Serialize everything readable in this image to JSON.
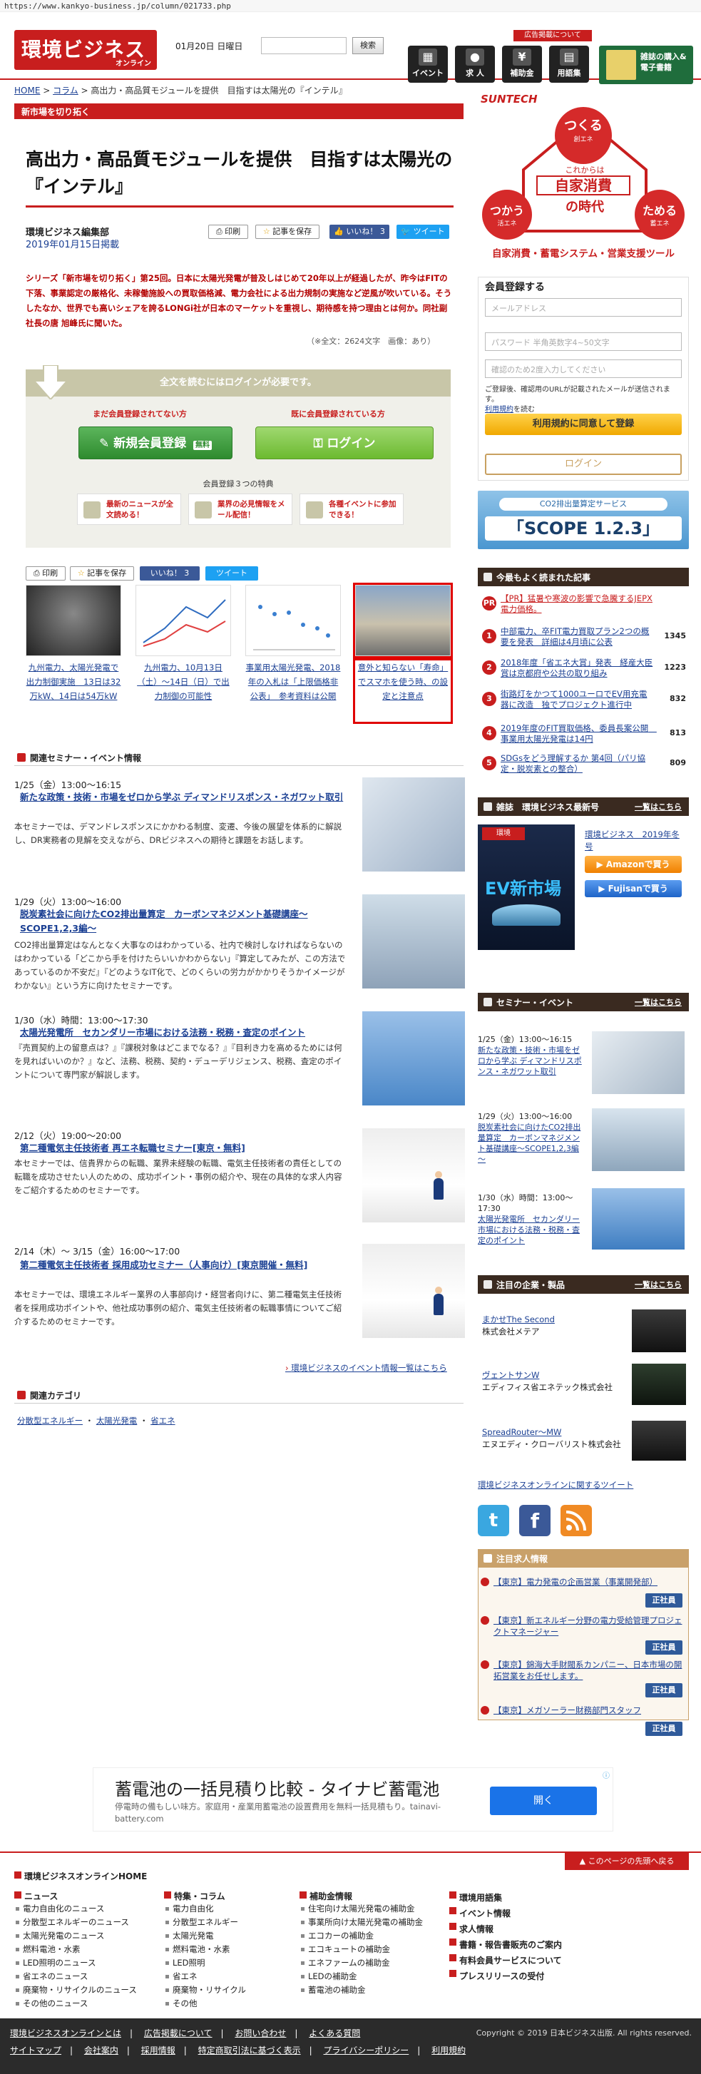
{
  "browser": {
    "url": "https://www.kankyo-business.jp/column/021733.php"
  },
  "header": {
    "logo_main": "環境ビジネス",
    "logo_sub": "オンライン",
    "date": "01月20日 日曜日",
    "search_button": "検索",
    "ad_label": "広告掲載について",
    "nav": [
      {
        "label": "イベント",
        "icon": "calendar-icon"
      },
      {
        "label": "求 人",
        "icon": "person-icon"
      },
      {
        "label": "補助金",
        "icon": "yen-icon"
      },
      {
        "label": "用語集",
        "icon": "book-icon"
      }
    ],
    "banner_text": "雑誌の購入&電子書籍"
  },
  "breadcrumb": [
    "HOME",
    "コラム",
    "高出力・高品質モジュールを提供　目指すは太陽光の『インテル』"
  ],
  "series_label": "新市場を切り拓く",
  "article": {
    "title": "高出力・高品質モジュールを提供　目指すは太陽光の『インテル』",
    "author": "環境ビジネス編集部",
    "published": "2019年01月15日掲載",
    "buttons": {
      "print": "印刷",
      "save": "記事を保存",
      "like": "いいね！ 3",
      "tweet": "ツイート"
    },
    "lead": "シリーズ「新市場を切り拓く」第25回。日本に太陽光発電が普及しはじめて20年以上が経過したが、昨今はFITの下落、事業認定の厳格化、未稼働施設への買取価格減、電力会社による出力規制の実施など逆風が吹いている。そうしたなか、世界でも高いシェアを誇るLONGi社が日本のマーケットを重視し、期待感を持つ理由とは何か。同社副社長の唐 旭峰氏に聞いた。",
    "lead_links": [
      "太陽光発電",
      "FIT"
    ],
    "stats": "（※全文：2624文字　画像：あり）"
  },
  "login_box": {
    "heading": "全文を読むにはログインが必要です。",
    "col_new": "まだ会員登録されてない方",
    "col_member": "既に会員登録されている方",
    "register_button": "新規会員登録",
    "register_badge": "無料",
    "login_button": "ログイン",
    "merits_title": "会員登録３つの特典",
    "merits": [
      "最新のニュースが全文読める！",
      "業界の必見情報をメール配信！",
      "各種イベントに参加できる！"
    ]
  },
  "related": [
    {
      "caption": "九州電力、太陽光発電で出力制御実施　13日は32万kW、14日は54万kW"
    },
    {
      "caption": "九州電力、10月13日（土）～14日（日）で出力制御の可能性"
    },
    {
      "caption": "事業用太陽光発電、2018年の入札は「上限価格非公表」　参考資料は公開"
    },
    {
      "caption": "意外と知らない「寿命」でスマホを使う時、の設定と注意点"
    }
  ],
  "seminars": {
    "heading": "関連セミナー・イベント情報",
    "items": [
      {
        "date": "1/25（金）13:00～16:15",
        "title": "新たな政策・技術・市場をゼロから学ぶ ディマンドリスポンス・ネガワット取引",
        "desc": "本セミナーでは、デマンドレスポンスにかかわる制度、変遷、今後の展望を体系的に解説し、DR実務者の見解を交えながら、DRビジネスへの期待と課題をお話します。"
      },
      {
        "date": "1/29（火）13:00～16:00",
        "title": "脱炭素社会に向けたCO2排出量算定　カーボンマネジメント基礎講座～SCOPE1,2,3編～",
        "desc": "CO2排出量算定はなんとなく大事なのはわかっている、社内で検討しなければならないのはわかっている「どこから手を付けたらいいかわからない」『算定してみたが、この方法であっているのか不安だ』『どのようなIT化で、どのくらいの労力がかかりそうかイメージがわかない』という方に向けたセミナーです。"
      },
      {
        "date": "1/30（水）時間：13:00～17:30",
        "title": "太陽光発電所　セカンダリー市場における法務・税務・査定のポイント",
        "desc": "『売買契約上の留意点は？』『課税対象はどこまでなる？』『目利き力を高めるためには何を見ればいいのか？』など、法務、税務、契約・デューデリジェンス、税務、査定のポイントについて専門家が解説します。"
      },
      {
        "date": "2/12（火）19:00～20:00",
        "title": "第二種電気主任技術者 再エネ転職セミナー[東京・無料]",
        "desc": "本セミナーでは、信貴界からの転職、業界未経験の転職、電気主任技術者の責任としての転職を成功させたい人のための、成功ポイント・事例の紹介や、現在の具体的な求人内容をご紹介するためのセミナーです。"
      },
      {
        "date": "2/14（木）～ 3/15（金）16:00～17:00",
        "title": "第二種電気主任技術者 採用成功セミナー（人事向け）[東京開催・無料]",
        "desc": "本セミナーでは、環境エネルギー業界の人事部向け・経営者向けに、第二種電気主任技術者を採用成功ポイントや、他社成功事例の紹介、電気主任技術者の転職事情についてご紹介するためのセミナーです。"
      }
    ],
    "more_link": "環境ビジネスのイベント情報一覧はこちら"
  },
  "categories": {
    "heading": "関連カテゴリ",
    "items": [
      "分散型エネルギー",
      "太陽光発電",
      "省エネ"
    ]
  },
  "sidebar": {
    "top_ad": {
      "brand": "SUNTECH",
      "line1": "つくる",
      "line1_sub": "創エネ",
      "center": "自家消費",
      "center_pre": "これからは",
      "center_post": "の時代",
      "left": "つかう",
      "left_sub": "活エネ",
      "right": "ためる",
      "right_sub": "蓄エネ",
      "tagline": "自家消費・蓄電システム・営業支援ツール"
    },
    "register": {
      "heading": "会員登録する",
      "email_placeholder": "メールアドレス",
      "password_placeholder": "パスワード 半角英数字4~50文字",
      "confirm_placeholder": "確認のため2度入力してください",
      "note": "ご登録後、確認用のURLが記載されたメールが送信されます。",
      "terms_link": "利用規約",
      "note2": "を読む",
      "submit": "利用規約に同意して登録",
      "login": "ログイン"
    },
    "scope_ad": {
      "top": "CO2排出量算定サービス",
      "main": "「SCOPE 1.2.3」"
    },
    "ranking": {
      "heading": "今最もよく読まれた記事",
      "items": [
        {
          "no": "PR",
          "title": "【PR】猛暑や寒波の影響で急騰するJEPX電力価格。",
          "count": ""
        },
        {
          "no": "1",
          "title": "中部電力、卒FIT電力買取プラン2つの概要を発表　詳細は4月頃に公表",
          "count": "1345"
        },
        {
          "no": "2",
          "title": "2018年度「省エネ大賞」発表　経産大臣賞は京都府や公共の取り組み",
          "count": "1223"
        },
        {
          "no": "3",
          "title": "街路灯をかつて1000ユーロでEV用充電器に改造　独でプロジェクト進行中",
          "count": "832"
        },
        {
          "no": "4",
          "title": "2019年度のFIT買取価格、委員長案公開　事業用太陽光発電は14円",
          "count": "813"
        },
        {
          "no": "5",
          "title": "SDGsをどう理解するか 第4回（パリ協定・脱炭素との整合）",
          "count": "809"
        }
      ]
    },
    "magazine": {
      "heading": "雑誌　環境ビジネス最新号",
      "more": "一覧はこちら",
      "issue": "環境ビジネス　2019年冬号",
      "cover_title": "EV新市場",
      "amazon": "Amazonで買う",
      "fujisan": "Fujisanで買う"
    },
    "side_seminars": {
      "heading": "セミナー・イベント",
      "more": "一覧はこちら",
      "items": [
        {
          "date": "1/25（金）13:00～16:15",
          "title": "新たな政策・技術・市場をゼロから学ぶ ディマンドリスポンス・ネガワット取引"
        },
        {
          "date": "1/29（火）13:00～16:00",
          "title": "脱炭素社会に向けたCO2排出量算定　カーボンマネジメント基礎講座～SCOPE1,2,3編～"
        },
        {
          "date": "1/30（水）時間：13:00～17:30",
          "title": "太陽光発電所　セカンダリー市場における法務・税務・査定のポイント"
        }
      ]
    },
    "companies": {
      "heading": "注目の企業・製品",
      "more": "一覧はこちら",
      "items": [
        {
          "name": "まかせThe Second",
          "company": "株式会社メテア"
        },
        {
          "name": "ヴェントサンW",
          "company": "エディフィス省エネテック株式会社"
        },
        {
          "name": "SpreadRouter～MW",
          "company": "エヌエディ・クローバリスト株式会社"
        }
      ]
    },
    "tweet_link": "環境ビジネスオンラインに関するツイート",
    "jobs": {
      "heading": "注目求人情報",
      "badge": "正社員",
      "items": [
        "【東京】電力発電の企画営業（事業開発部）",
        "【東京】新エネルギー分野の電力受給管理プロジェクトマネージャー",
        "【東京】錦海大手財閥系カンパニー、日本市場の開拓営業をお任せします。",
        "【東京】メガソーラー財務部門スタッフ"
      ]
    }
  },
  "bottom_ad": {
    "title": "蓄電池の一括見積り比較 - タイナビ蓄電池",
    "desc": "停電時の備もしい味方。家庭用・産業用蓄電池の設置費用を無料一括見積もり。tainavi-battery.com",
    "button": "開く"
  },
  "footer": {
    "top_link": "このページの先頭へ戻る",
    "home": "環境ビジネスオンラインHOME",
    "cols": [
      {
        "title": "ニュース",
        "items": [
          "電力自由化のニュース",
          "分散型エネルギーのニュース",
          "太陽光発電のニュース",
          "燃料電池・水素",
          "LED照明のニュース",
          "省エネのニュース",
          "廃棄物・リサイクルのニュース",
          "その他のニュース"
        ]
      },
      {
        "title": "特集・コラム",
        "items": [
          "電力自由化",
          "分散型エネルギー",
          "太陽光発電",
          "燃料電池・水素",
          "LED照明",
          "省エネ",
          "廃棄物・リサイクル",
          "その他"
        ]
      },
      {
        "title": "補助金情報",
        "items": [
          "住宅向け太陽光発電の補助金",
          "事業所向け太陽光発電の補助金",
          "エコカーの補助金",
          "エコキュートの補助金",
          "エネファームの補助金",
          "LEDの補助金",
          "蓄電池の補助金"
        ]
      },
      {
        "title": "環境用語集",
        "items": [
          "イベント情報",
          "求人情報",
          "書籍・報告書販売のご案内",
          "有料会員サービスについて",
          "プレスリリースの受付"
        ]
      }
    ],
    "links_row1": [
      "環境ビジネスオンラインとは",
      "広告掲載について",
      "お問い合わせ",
      "よくある質問"
    ],
    "links_row2": [
      "サイトマップ",
      "会社案内",
      "採用情報",
      "特定商取引法に基づく表示",
      "プライバシーポリシー",
      "利用規約"
    ],
    "copyright": "Copyright © 2019 日本ビジネス出版. All rights reserved."
  }
}
